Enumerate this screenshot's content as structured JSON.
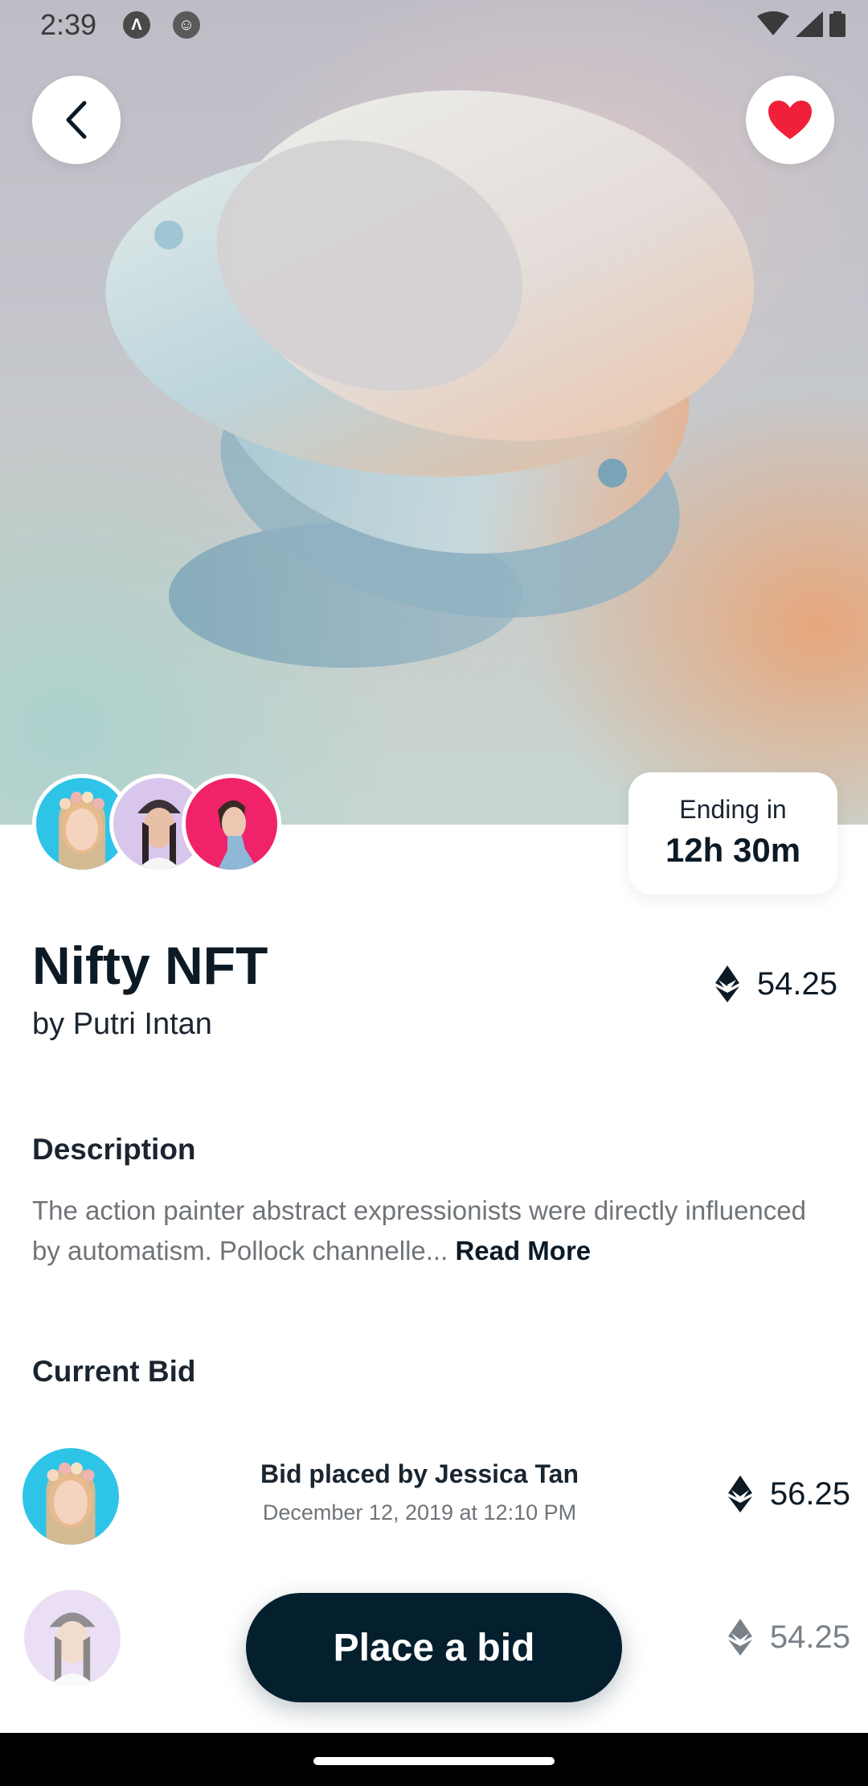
{
  "status_bar": {
    "time": "2:39"
  },
  "nft": {
    "title": "Nifty NFT",
    "author": "by Putri Intan",
    "price": "54.25",
    "ending_label": "Ending in",
    "ending_value": "12h 30m"
  },
  "description": {
    "heading": "Description",
    "text": "The action painter abstract expressionists were directly influenced by automatism. Pollock channelle...",
    "read_more": "Read More"
  },
  "bids": {
    "heading": "Current Bid",
    "items": [
      {
        "who": "Bid placed by Jessica Tan",
        "date": "December 12, 2019 at 12:10 PM",
        "amount": "56.25"
      },
      {
        "who": "",
        "date": "",
        "amount": "54.25"
      }
    ]
  },
  "actions": {
    "place_bid": "Place a bid"
  },
  "colors": {
    "primary_dark": "#04202e",
    "heart_red": "#f0203a",
    "avatar_cyan": "#2ec4e8",
    "avatar_lavender": "#d9c6ec",
    "avatar_pink": "#f0226a"
  },
  "icons": {
    "back": "chevron-left-icon",
    "favorite": "heart-icon",
    "currency": "ethereum-icon"
  }
}
